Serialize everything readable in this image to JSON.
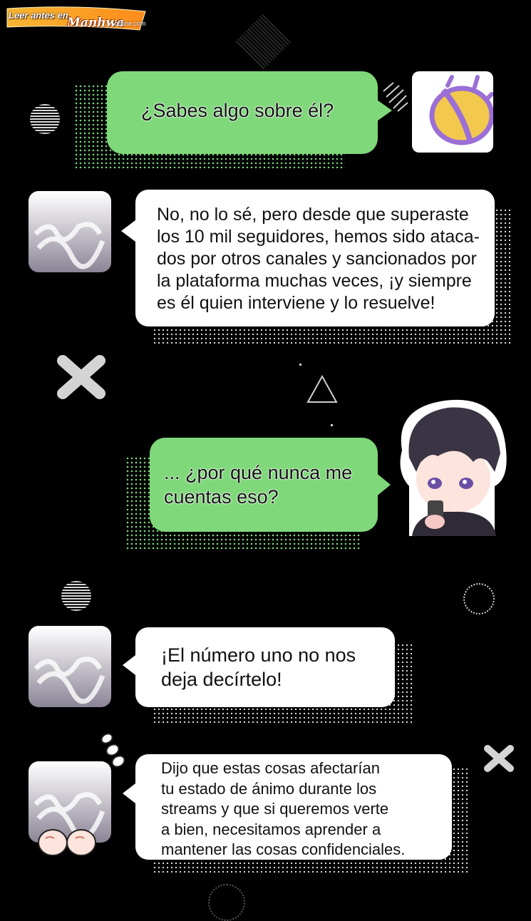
{
  "watermark": {
    "line1": "Leer antes en",
    "brand": "Manhwa",
    "domain": "-online.com"
  },
  "messages": [
    {
      "sender": "user",
      "text": "¿Sabes algo sobre él?"
    },
    {
      "sender": "other",
      "text": "No, no lo sé, pero desde que superaste\nlos 10 mil seguidores, hemos sido ataca-\ndos por otros canales y sancionados por\nla plataforma muchas veces, ¡y siempre\nes él quien interviene y lo resuelve!"
    },
    {
      "sender": "user",
      "text": "... ¿por qué nunca me\ncuentas eso?"
    },
    {
      "sender": "other",
      "text": "¡El número uno no nos\ndeja decírtelo!"
    },
    {
      "sender": "other",
      "text": "Dijo que estas cosas afectarían\ntu estado de ánimo durante los\nstreams y que si queremos verte\na bien, necesitamos aprender a\nmantener las cosas confidenciales."
    }
  ],
  "colors": {
    "background": "#000000",
    "user_bubble": "#7fd87a",
    "other_bubble": "#ffffff",
    "icon_purple": "#9b6fd6",
    "icon_yellow": "#f2c94c"
  },
  "icons": [
    "x-mark-icon",
    "triangle-icon",
    "striped-circle-icon",
    "dotted-circle-icon",
    "sweat-drops-icon",
    "fists-icon"
  ]
}
